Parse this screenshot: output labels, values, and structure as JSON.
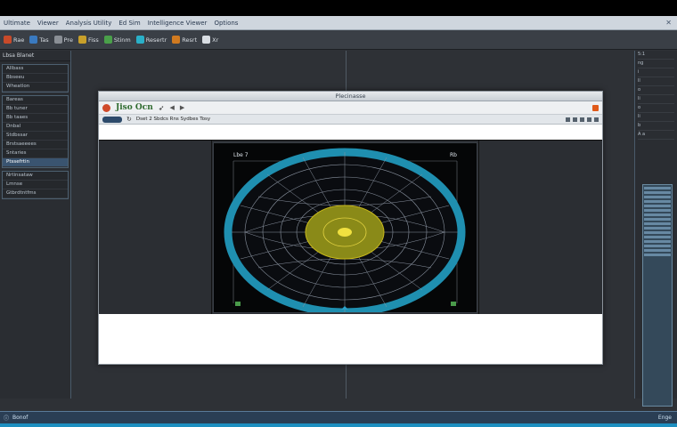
{
  "topbar": {
    "items": [
      "Ultimate",
      "Viewer",
      "Analysis Utility",
      "Ed Sim",
      "Intelligence Viewer",
      "Options"
    ]
  },
  "toolbar": {
    "buttons": [
      {
        "label": "Rae",
        "icon": "red-square-icon",
        "color": "#c84a2a"
      },
      {
        "label": "Tas",
        "icon": "blue-square-icon",
        "color": "#3a7ac0"
      },
      {
        "label": "Pre",
        "icon": "gray-square-icon",
        "color": "#8a8f96"
      },
      {
        "label": "Fiss",
        "icon": "yellow-square-icon",
        "color": "#c8a02a"
      },
      {
        "label": "Stinm",
        "icon": "green-square-icon",
        "color": "#4aa04a"
      },
      {
        "label": "Resertr",
        "icon": "cyan-square-icon",
        "color": "#2ab0c8"
      },
      {
        "label": "Resrt",
        "icon": "orange-square-icon",
        "color": "#d07a20"
      },
      {
        "label": "Xr",
        "icon": "white-square-icon",
        "color": "#d8dde3"
      }
    ]
  },
  "left_panel": {
    "title": "Lbsa Blanet",
    "groups": [
      {
        "rows": [
          "Allbass",
          "Bbseeu",
          "Wheatlon"
        ]
      },
      {
        "rows": [
          "Bareas",
          "Bb tuner",
          "Bb taaes",
          "Dnbal",
          "Stdbssar",
          "Brstsaeeees",
          "Sntaries",
          "Ptssefrtin"
        ]
      },
      {
        "rows": [
          "Nrtinsataw",
          "Lmnse",
          "Gtbrdtntfms"
        ]
      }
    ],
    "selected_row": "Ptssefrtin"
  },
  "right_panel": {
    "rows": [
      "5:1",
      "ng",
      "i",
      "ll",
      "o",
      "li",
      "o",
      "li",
      "b",
      "A a"
    ]
  },
  "dialog": {
    "title": "Plecinasse",
    "app_name": "Jiso Ocn",
    "address_text": "Dset 2 Sbdcs Rns Sydbes Tosy",
    "radar_label_left": "Lbe 7",
    "radar_label_right": "Rb",
    "accent": "#2aa0c8",
    "core_color": "#c8b81a"
  },
  "statusbar": {
    "left": "Bonof",
    "right": "Enge"
  }
}
